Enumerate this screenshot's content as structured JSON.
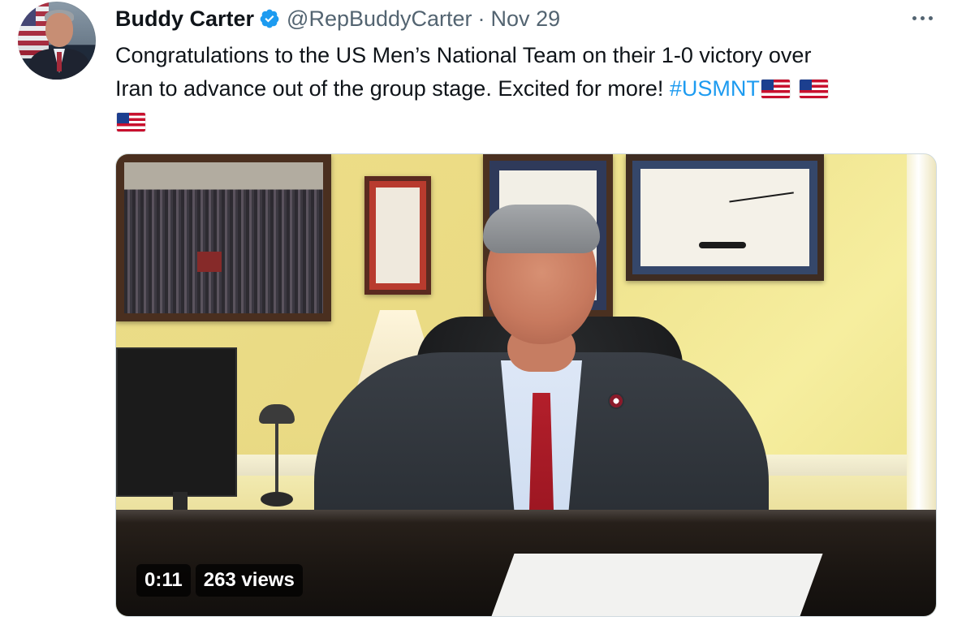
{
  "tweet": {
    "author": {
      "name": "Buddy Carter",
      "verified_icon": "verified-badge-icon",
      "handle": "@RepBuddyCarter",
      "separator": "·",
      "date": "Nov 29"
    },
    "more_icon": "more-options-icon",
    "text": {
      "line_1": "Congratulations to the US Men’s National Team on their 1-0 victory over",
      "line_2_prefix": "Iran to advance out of the group stage. Excited for more! ",
      "hashtag": "#USMNT",
      "flag_emojis": [
        "us-flag",
        "us-flag",
        "us-flag"
      ]
    },
    "media": {
      "type": "video",
      "duration": "0:11",
      "views": "263 views"
    }
  },
  "colors": {
    "text": "#0f1419",
    "muted": "#536471",
    "link": "#1d9bf0",
    "verified": "#1d9bf0"
  }
}
